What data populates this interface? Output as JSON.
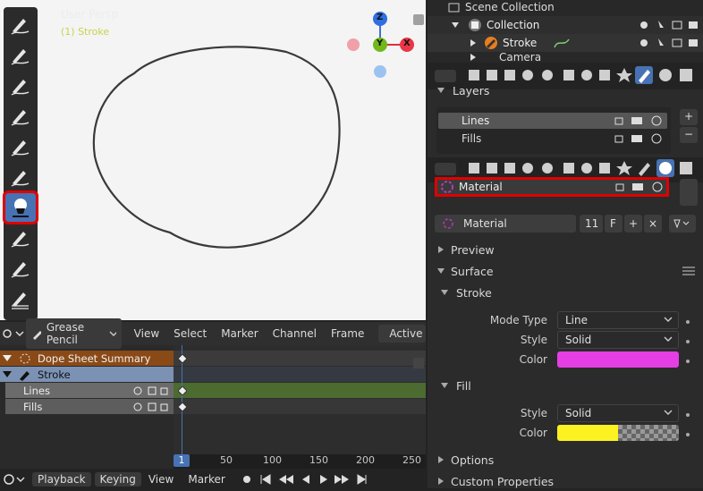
{
  "viewport": {
    "title": "User Persp",
    "subtitle": "(1) Stroke",
    "gizmo": {
      "z": "Z",
      "y": "Y",
      "x": "X"
    }
  },
  "toolbar": {
    "tools": [
      "draw-pencil-icon",
      "draw-ink-icon",
      "draw-pen-icon",
      "draw-marker-icon",
      "draw-chisel-icon",
      "draw-airbrush-icon",
      "fill-bucket-icon",
      "erase-icon",
      "tint-icon",
      "cutter-icon"
    ],
    "active_index": 6
  },
  "timeline": {
    "editor_mode": "Grease Pencil",
    "menu": [
      "View",
      "Select",
      "Marker",
      "Channel",
      "Frame"
    ],
    "active_label": "Active",
    "channels": [
      {
        "name": "Dope Sheet Summary",
        "kind": "summary"
      },
      {
        "name": "Stroke",
        "kind": "object"
      },
      {
        "name": "Lines",
        "kind": "layer"
      },
      {
        "name": "Fills",
        "kind": "layer"
      }
    ],
    "ruler": [
      "1",
      "50",
      "100",
      "150",
      "200",
      "250"
    ],
    "current_frame": "1"
  },
  "bottom_bar": {
    "playback": "Playback",
    "keying": "Keying",
    "view": "View",
    "marker": "Marker"
  },
  "outliner": {
    "rows": [
      {
        "name": "Scene Collection"
      },
      {
        "name": "Collection"
      },
      {
        "name": "Stroke"
      },
      {
        "name": "Camera"
      }
    ]
  },
  "properties": {
    "layers_section": "Layers",
    "layers": [
      "Lines",
      "Fills"
    ],
    "material_slot": "Material",
    "material_name": "Material",
    "material_users": "11",
    "fake_user": "F",
    "sections": {
      "preview": "Preview",
      "surface": "Surface",
      "stroke": "Stroke",
      "fill": "Fill",
      "options": "Options",
      "custom": "Custom Properties"
    },
    "stroke": {
      "mode_type_label": "Mode Type",
      "mode_type": "Line",
      "style_label": "Style",
      "style": "Solid",
      "color_label": "Color",
      "color": "#e53ee4"
    },
    "fill": {
      "style_label": "Style",
      "style": "Solid",
      "color_label": "Color",
      "color": "#fdf221"
    }
  }
}
